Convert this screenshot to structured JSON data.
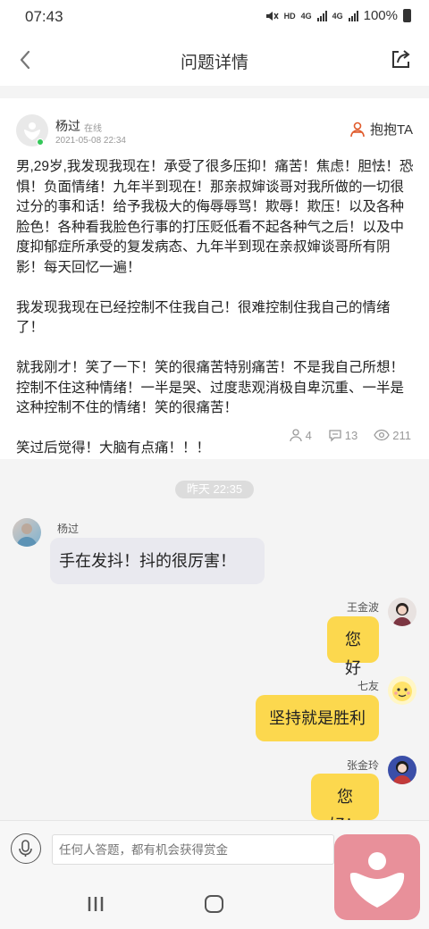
{
  "status_bar": {
    "time": "07:43",
    "network_label": "HD",
    "net_a": "4G",
    "net_b": "4G",
    "battery": "100%"
  },
  "header": {
    "title": "问题详情",
    "back_icon": "chevron-left-icon",
    "share_icon": "share-icon"
  },
  "post": {
    "author": "杨过",
    "status": "在线",
    "date": "2021-05-08 22:34",
    "hug_label": "抱抱TA",
    "paragraphs": [
      "男,29岁,我发现我现在！承受了很多压抑！痛苦！焦虑！胆怯！恐惧！负面情绪！九年半到现在！那亲叔婶谈哥对我所做的一切很过分的事和话！给予我极大的侮辱辱骂！欺辱！欺压！以及各种脸色！各种看我脸色行事的打压贬低看不起各种气之后！以及中度抑郁症所承受的复发病态、九年半到现在亲叔婶谈哥所有阴影！每天回忆一遍！",
      "我发现我现在已经控制不住我自己！很难控制住我自己的情绪了！",
      "就我刚才！笑了一下！笑的很痛苦特别痛苦！不是我自己所想！控制不住这种情绪！一半是哭、过度悲观消极自卑沉重、一半是这种控制不住的情绪！笑的很痛苦！",
      "笑过后觉得！大脑有点痛！！！"
    ],
    "stats": {
      "hugs": "4",
      "comments": "13",
      "views": "211"
    }
  },
  "chat": {
    "time_badge": "昨天 22:35",
    "messages": [
      {
        "name": "杨过",
        "text": "手在发抖！抖的很厉害！"
      },
      {
        "name": "王金波",
        "text": "您好"
      },
      {
        "name": "七友",
        "text": "坚持就是胜利"
      },
      {
        "name": "张金玲",
        "text": "您好！"
      }
    ]
  },
  "input": {
    "placeholder": "任何人答题，都有机会获得赏金"
  },
  "colors": {
    "bubble_right": "#fcd84e",
    "bubble_left": "#e9e9ef",
    "hug_accent": "#e05a2b",
    "float_heart_bg": "#e8909a"
  }
}
